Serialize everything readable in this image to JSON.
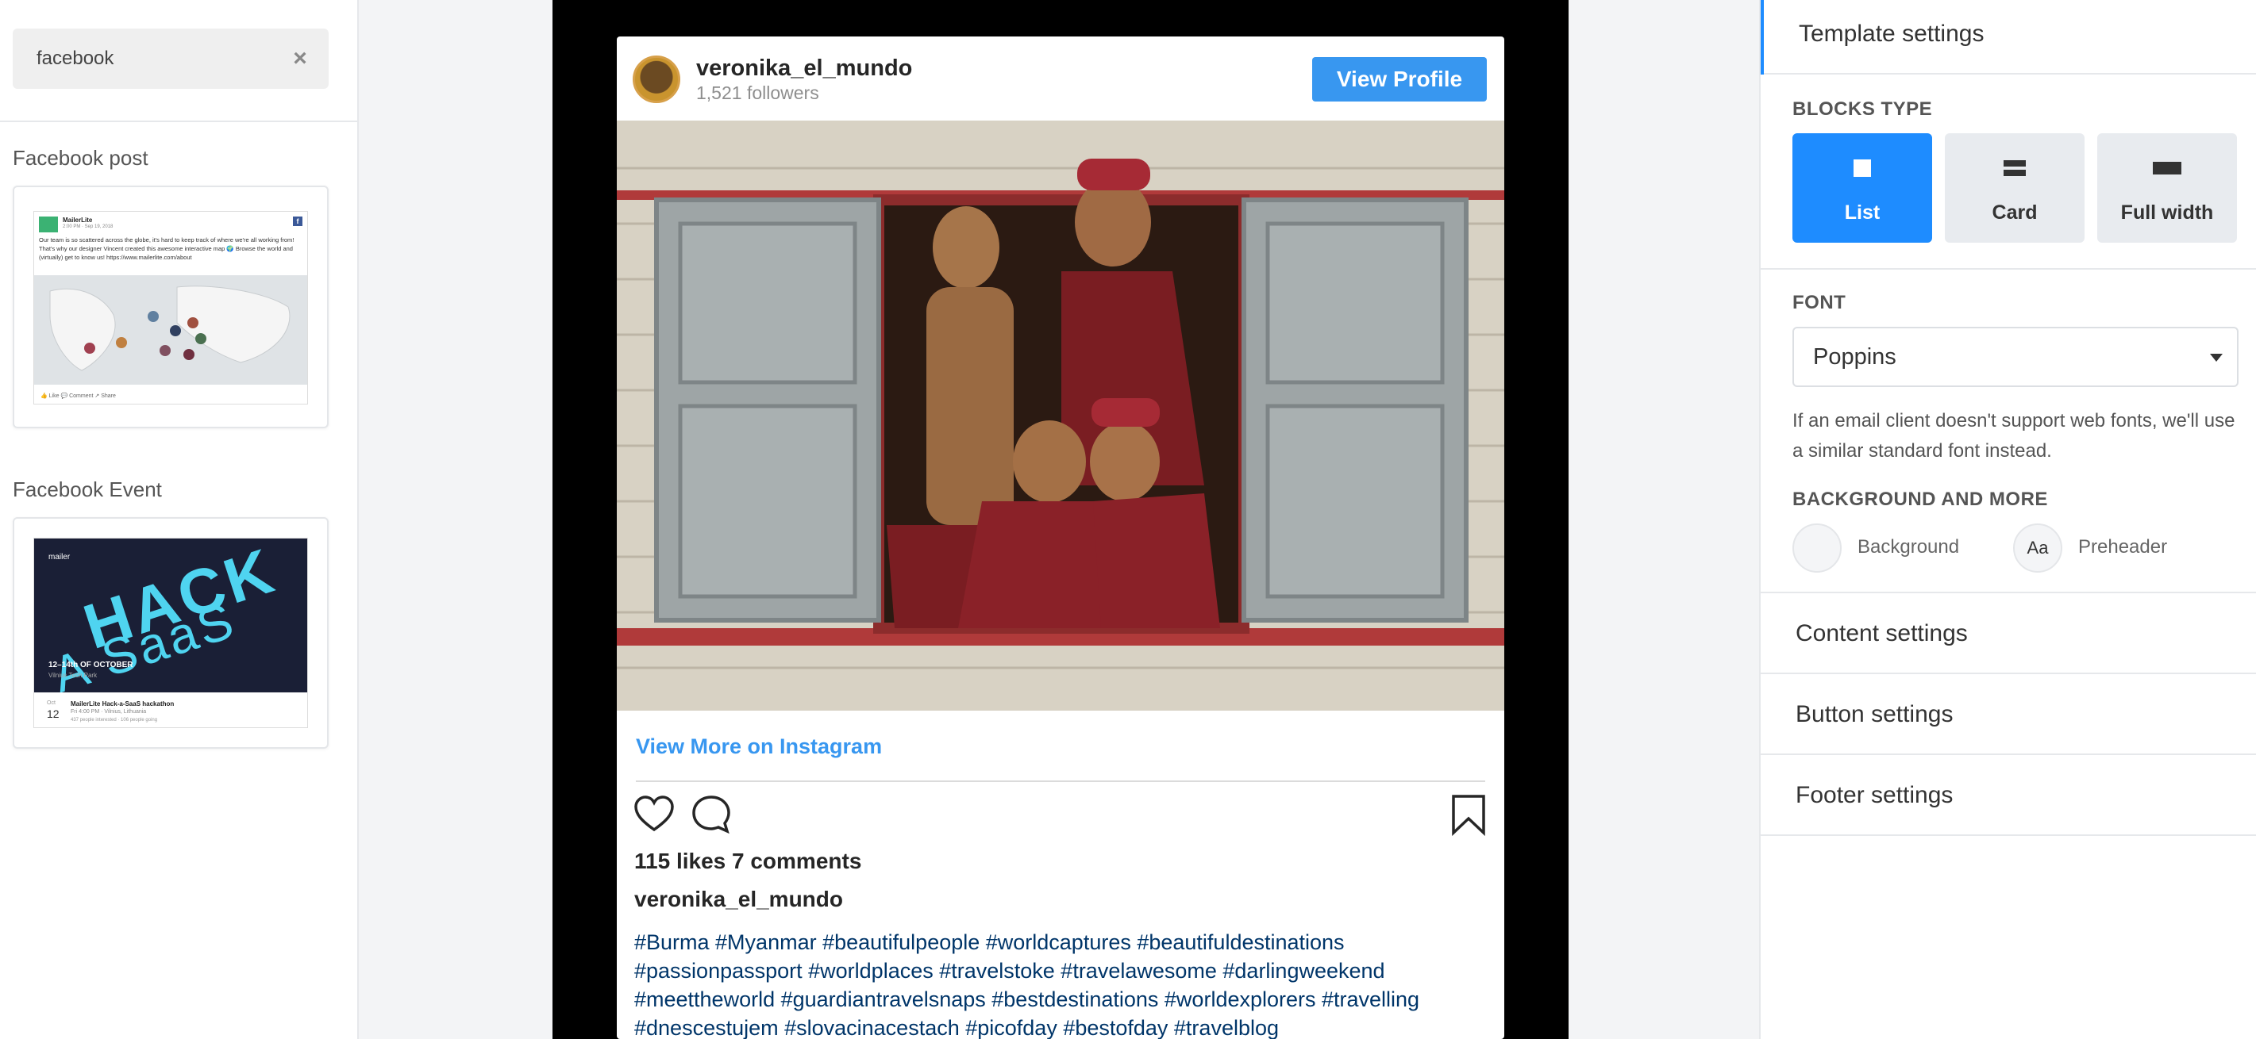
{
  "search": {
    "value": "facebook",
    "clear_icon": "close-icon"
  },
  "sections": {
    "fb_post": {
      "title": "Facebook post",
      "thumb": {
        "name": "MailerLite",
        "sub": "2:00 PM · Sep 19, 2018",
        "text": "Our team is so scattered across the globe, it's hard to keep track of where we're all working from! That's why our designer Vincent created this awesome interactive map 🌍 Browse the world and (virtually) get to know us! https://www.mailerlite.com/about",
        "actions": "👍 Like    💬 Comment    ↗ Share"
      }
    },
    "fb_event": {
      "title": "Facebook Event",
      "thumb": {
        "mailer": "mailer",
        "hack": "HACK",
        "saas": "A SaaS",
        "date": "12–14th OF OCTOBER",
        "loc": "Vilnius Tech Park",
        "month": "Oct",
        "day": "12",
        "event_title": "MailerLite Hack-a-SaaS hackathon",
        "event_sub": "Fri 4:00 PM · Vilnius, Lithuania",
        "event_sub2": "437 people interested · 106 people going"
      }
    }
  },
  "instagram": {
    "username": "veronika_el_mundo",
    "followers": "1,521 followers",
    "view_profile": "View Profile",
    "view_more": "View More on Instagram",
    "likes_comments": "115 likes 7 comments",
    "caption_user": "veronika_el_mundo",
    "tags": [
      "#Burma #Myanmar #beautifulpeople #worldcaptures #beautifuldestinations",
      "#passionpassport #worldplaces #travelstoke #travelawesome #darlingweekend",
      "#meettheworld #guardiantravelsnaps #bestdestinations #worldexplorers #travelling",
      "#dnescestujem #slovacinacestach #picofday #bestofday #travelblog"
    ],
    "colors": {
      "link": "#3897f0",
      "tag": "#003569"
    }
  },
  "settings": {
    "template_title": "Template settings",
    "blocks_type_label": "BLOCKS TYPE",
    "blocks": [
      {
        "label": "List",
        "icon": "list-block-icon",
        "active": true
      },
      {
        "label": "Card",
        "icon": "card-block-icon",
        "active": false
      },
      {
        "label": "Full width",
        "icon": "full-width-block-icon",
        "active": false
      }
    ],
    "font_label": "FONT",
    "font_value": "Poppins",
    "font_note": "If an email client doesn't support web fonts, we'll use a similar standard font instead.",
    "bg_label": "BACKGROUND AND MORE",
    "background_label": "Background",
    "preheader_icon_text": "Aa",
    "preheader_label": "Preheader",
    "content_settings": "Content settings",
    "button_settings": "Button settings",
    "footer_settings": "Footer settings",
    "accent": "#1e8cff"
  }
}
